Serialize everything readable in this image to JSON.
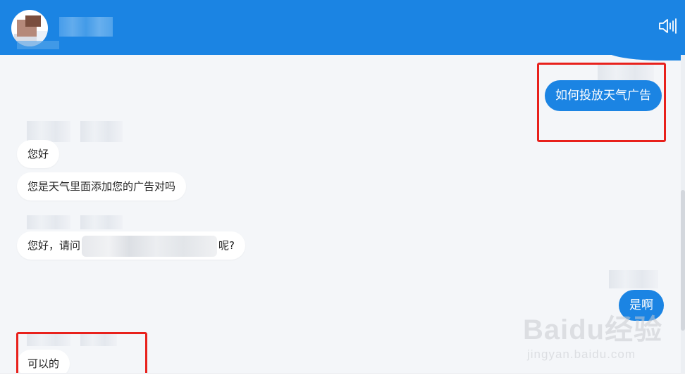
{
  "colors": {
    "header_bg": "#1b84e3",
    "chat_bg": "#f4f6f9",
    "user_bubble": "#1b84e3",
    "agent_bubble": "#ffffff",
    "highlight_box": "#e8211c"
  },
  "header": {
    "avatar_icon": "avatar-icon",
    "speaker_icon": "speaker-icon"
  },
  "messages": {
    "user_1": "如何投放天气广告",
    "agent_1": "您好",
    "agent_2": "您是天气里面添加您的广告对吗",
    "agent_3_prefix": "您好，请问",
    "agent_3_suffix": "呢?",
    "user_2": "是啊",
    "agent_4": "可以的"
  },
  "watermark": {
    "logo": "Baidu经验",
    "url": "jingyan.baidu.com"
  }
}
